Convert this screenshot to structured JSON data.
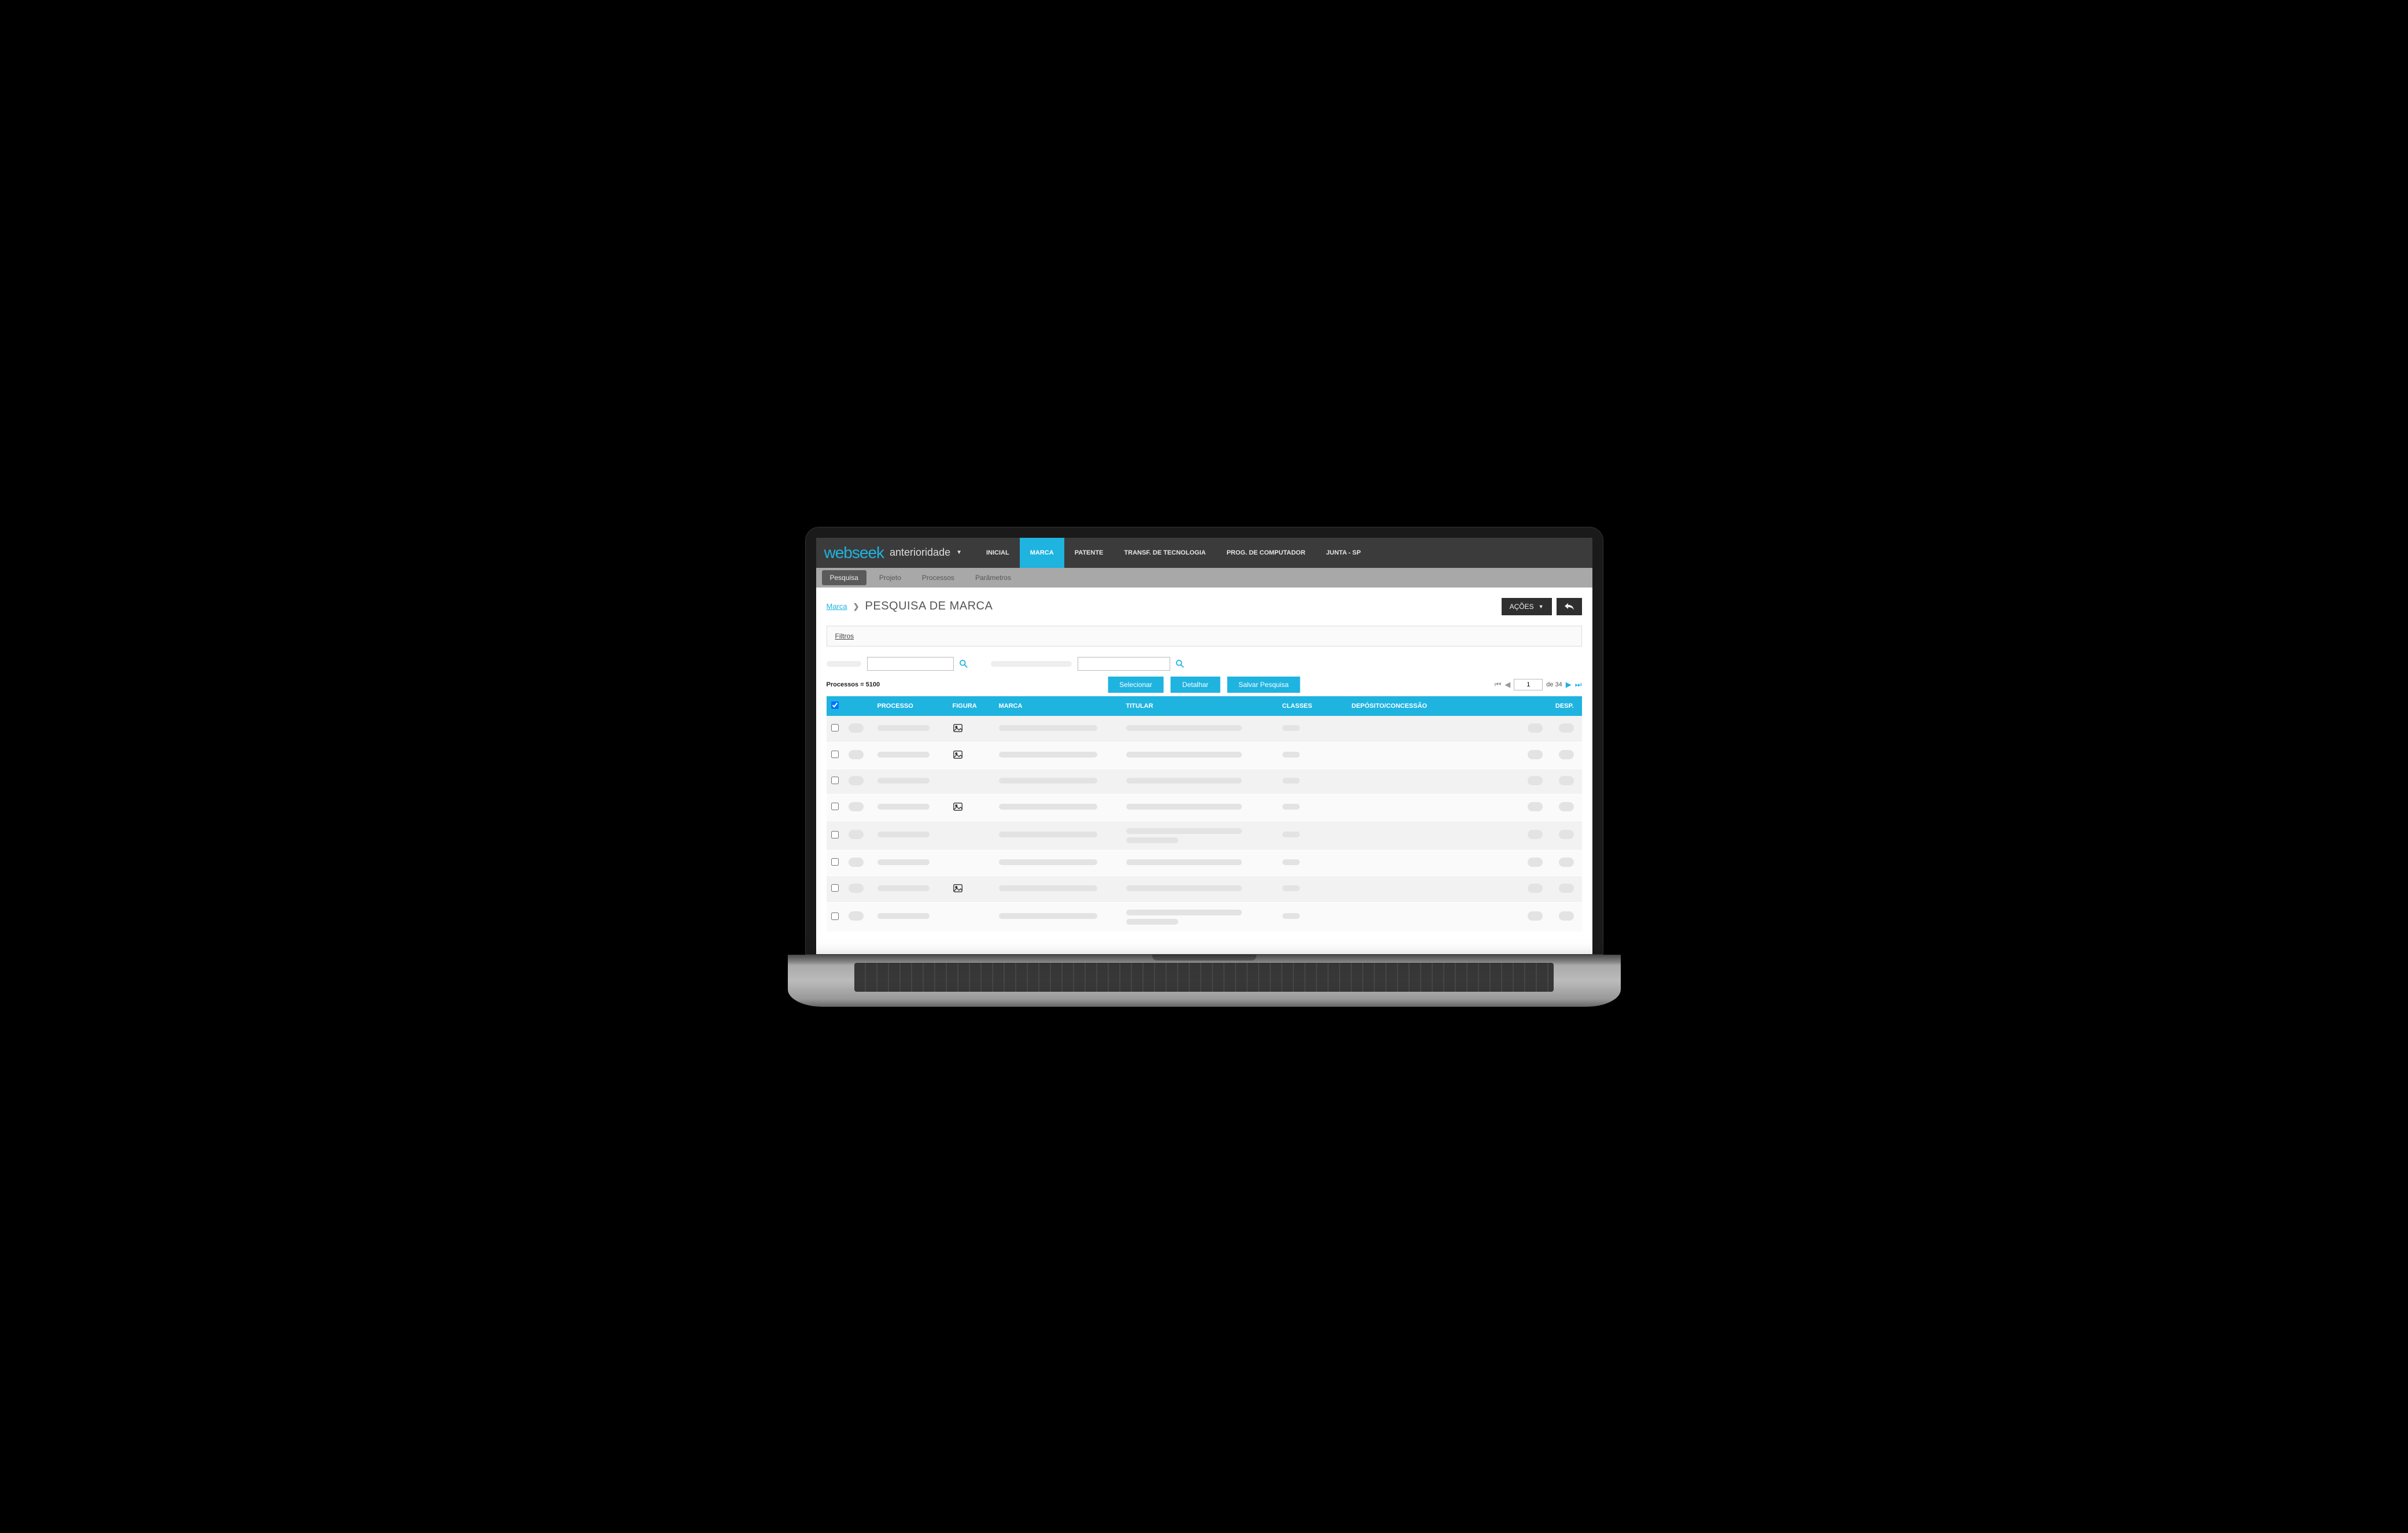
{
  "brand": {
    "name": "webseek",
    "sub": "anterioridade"
  },
  "topnav": [
    {
      "label": "INICIAL",
      "active": false
    },
    {
      "label": "MARCA",
      "active": true
    },
    {
      "label": "PATENTE",
      "active": false
    },
    {
      "label": "TRANSF. DE TECNOLOGIA",
      "active": false
    },
    {
      "label": "PROG. DE COMPUTADOR",
      "active": false
    },
    {
      "label": "JUNTA - SP",
      "active": false
    }
  ],
  "subtabs": [
    {
      "label": "Pesquisa",
      "active": true
    },
    {
      "label": "Projeto",
      "active": false
    },
    {
      "label": "Processos",
      "active": false
    },
    {
      "label": "Parâmetros",
      "active": false
    }
  ],
  "breadcrumb": {
    "link": "Marca",
    "title": "PESQUISA DE MARCA"
  },
  "actions": {
    "label": "AÇÕES"
  },
  "filters": {
    "label": "Filtros"
  },
  "count": {
    "label": "Processos = 5100"
  },
  "buttons": {
    "select": "Selecionar",
    "detail": "Detalhar",
    "save": "Salvar Pesquisa"
  },
  "pager": {
    "page": "1",
    "total": "de 34"
  },
  "columns": {
    "processo": "PROCESSO",
    "figura": "FIGURA",
    "marca": "MARCA",
    "titular": "TITULAR",
    "classes": "CLASSES",
    "deposito": "DEPÓSITO/CONCESSÃO",
    "desp": "DESP."
  },
  "rows": [
    {
      "figura": true,
      "double_titular": false
    },
    {
      "figura": true,
      "double_titular": false
    },
    {
      "figura": false,
      "double_titular": false
    },
    {
      "figura": true,
      "double_titular": false
    },
    {
      "figura": false,
      "double_titular": true
    },
    {
      "figura": false,
      "double_titular": false
    },
    {
      "figura": true,
      "double_titular": false
    },
    {
      "figura": false,
      "double_titular": true
    }
  ]
}
